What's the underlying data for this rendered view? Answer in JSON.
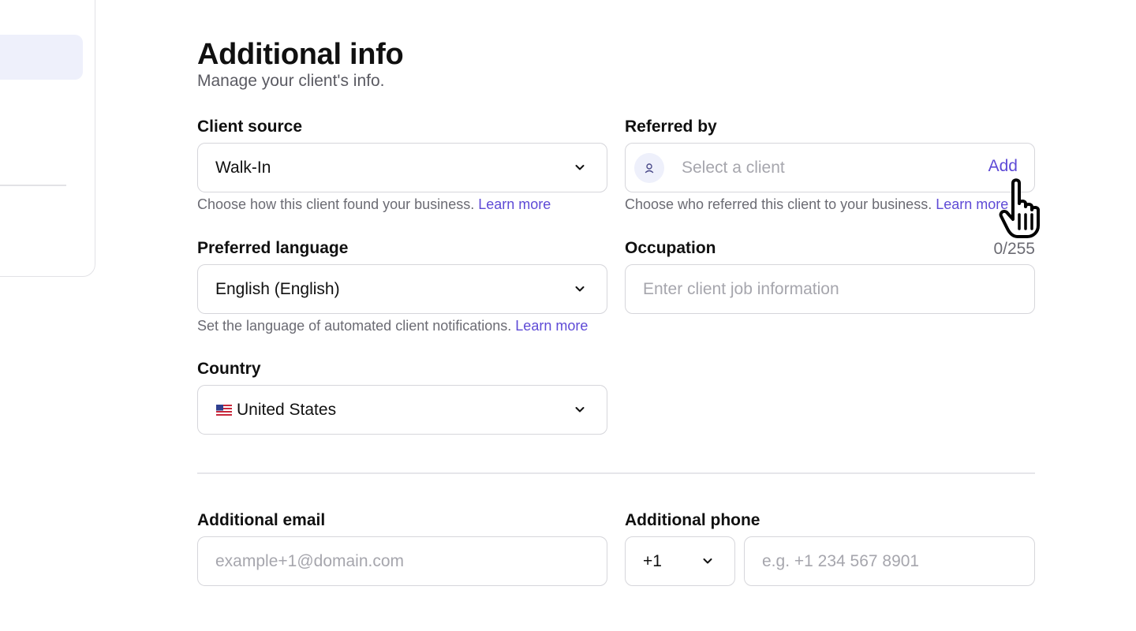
{
  "header": {
    "title": "Additional info",
    "subtitle": "Manage your client's info."
  },
  "client_source": {
    "label": "Client source",
    "value": "Walk-In",
    "help": "Choose how this client found your business.",
    "help_link": "Learn more"
  },
  "referred_by": {
    "label": "Referred by",
    "placeholder": "Select a client",
    "add_label": "Add",
    "help": "Choose who referred this client to your business.",
    "help_link": "Learn more"
  },
  "preferred_language": {
    "label": "Preferred language",
    "value": "English (English)",
    "help": "Set the language of automated client notifications.",
    "help_link": "Learn more"
  },
  "occupation": {
    "label": "Occupation",
    "counter": "0/255",
    "placeholder": "Enter client job information"
  },
  "country": {
    "label": "Country",
    "value": "United States",
    "flag_icon": "us-flag-icon"
  },
  "additional_email": {
    "label": "Additional email",
    "placeholder": "example+1@domain.com"
  },
  "additional_phone": {
    "label": "Additional phone",
    "country_code": "+1",
    "placeholder": "e.g. +1 234 567 8901"
  },
  "colors": {
    "accent": "#5e4ad6",
    "border": "#d6d6db",
    "muted_text": "#6b6b73",
    "placeholder": "#a6a6ad"
  }
}
